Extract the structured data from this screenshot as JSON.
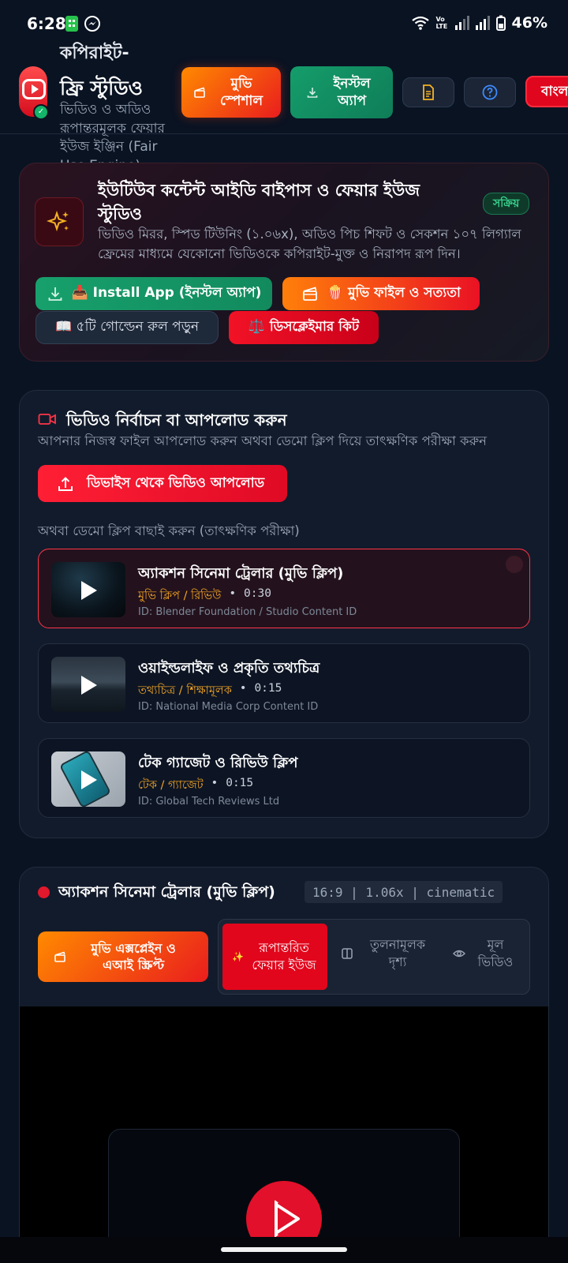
{
  "status": {
    "time": "6:28",
    "battery": "46%",
    "volte": "Vo LTE"
  },
  "header": {
    "title_cut": "কপিরাইট-",
    "title": "ফ্রি স্টুডিও",
    "subtitle": "ভিডিও ও অডিও রূপান্তরমূলক ফেয়ার ইউজ ইঞ্জিন (Fair Use Engine)",
    "movie_special": "মুভি স্পেশাল",
    "install_app": "ইনস্টল অ্যাপ",
    "lang": "বাংলা"
  },
  "hero": {
    "title": "ইউটিউব কন্টেন্ট আইডি বাইপাস ও ফেয়ার ইউজ স্টুডিও",
    "badge": "সক্রিয়",
    "desc": "ভিডিও মিরর, স্পিড টিউনিং (১.০৬x), অডিও পিচ শিফট ও সেকশন ১০৭ লিগ্যাল ফ্রেমের মাধ্যমে যেকোনো ভিডিওকে কপিরাইট-মুক্ত ও নিরাপদ রূপ দিন।",
    "btn_install": "📥 Install App (ইনস্টল অ্যাপ)",
    "btn_moviefile": "🍿 মুভি ফাইল ও সত্যতা",
    "btn_golden": "📖 ৫টি গোল্ডেন রুল পড়ুন",
    "btn_disclaimer": "⚖️ ডিসক্লেইমার কিট"
  },
  "video_select": {
    "title": "ভিডিও নির্বাচন বা আপলোড করুন",
    "subtitle": "আপনার নিজস্ব ফাইল আপলোড করুন অথবা ডেমো ক্লিপ দিয়ে তাৎক্ষণিক পরীক্ষা করুন",
    "upload": "ডিভাইস থেকে ভিডিও আপলোড",
    "demo_label": "অথবা ডেমো ক্লিপ বাছাই করুন (তাৎক্ষণিক পরীক্ষা)",
    "clips": [
      {
        "title": "অ্যাকশন সিনেমা ট্রেলার (মুভি ক্লিপ)",
        "category": "মুভি ক্লিপ / রিভিউ",
        "duration": "0:30",
        "id": "ID: Blender Foundation / Studio Content ID",
        "active": true
      },
      {
        "title": "ওয়াইল্ডলাইফ ও প্রকৃতি তথ্যচিত্র",
        "category": "তথ্যচিত্র / শিক্ষামূলক",
        "duration": "0:15",
        "id": "ID: National Media Corp Content ID",
        "active": false
      },
      {
        "title": "টেক গ্যাজেট ও রিভিউ ক্লিপ",
        "category": "টেক / গ্যাজেট",
        "duration": "0:15",
        "id": "ID: Global Tech Reviews Ltd",
        "active": false
      }
    ],
    "dot": "•"
  },
  "player": {
    "title": "অ্যাকশন সিনেমা ট্রেলার (মুভি ক্লিপ)",
    "spec": "16:9 | 1.06x | cinematic",
    "explain": "মুভি এক্সপ্লেইন ও এআই স্ক্রিপ্ট",
    "seg_transformed": "রূপান্তরিত ফেয়ার ইউজ",
    "seg_compare": "তুলনামূলক দৃশ্য",
    "seg_original": "মূল ভিডিও"
  }
}
